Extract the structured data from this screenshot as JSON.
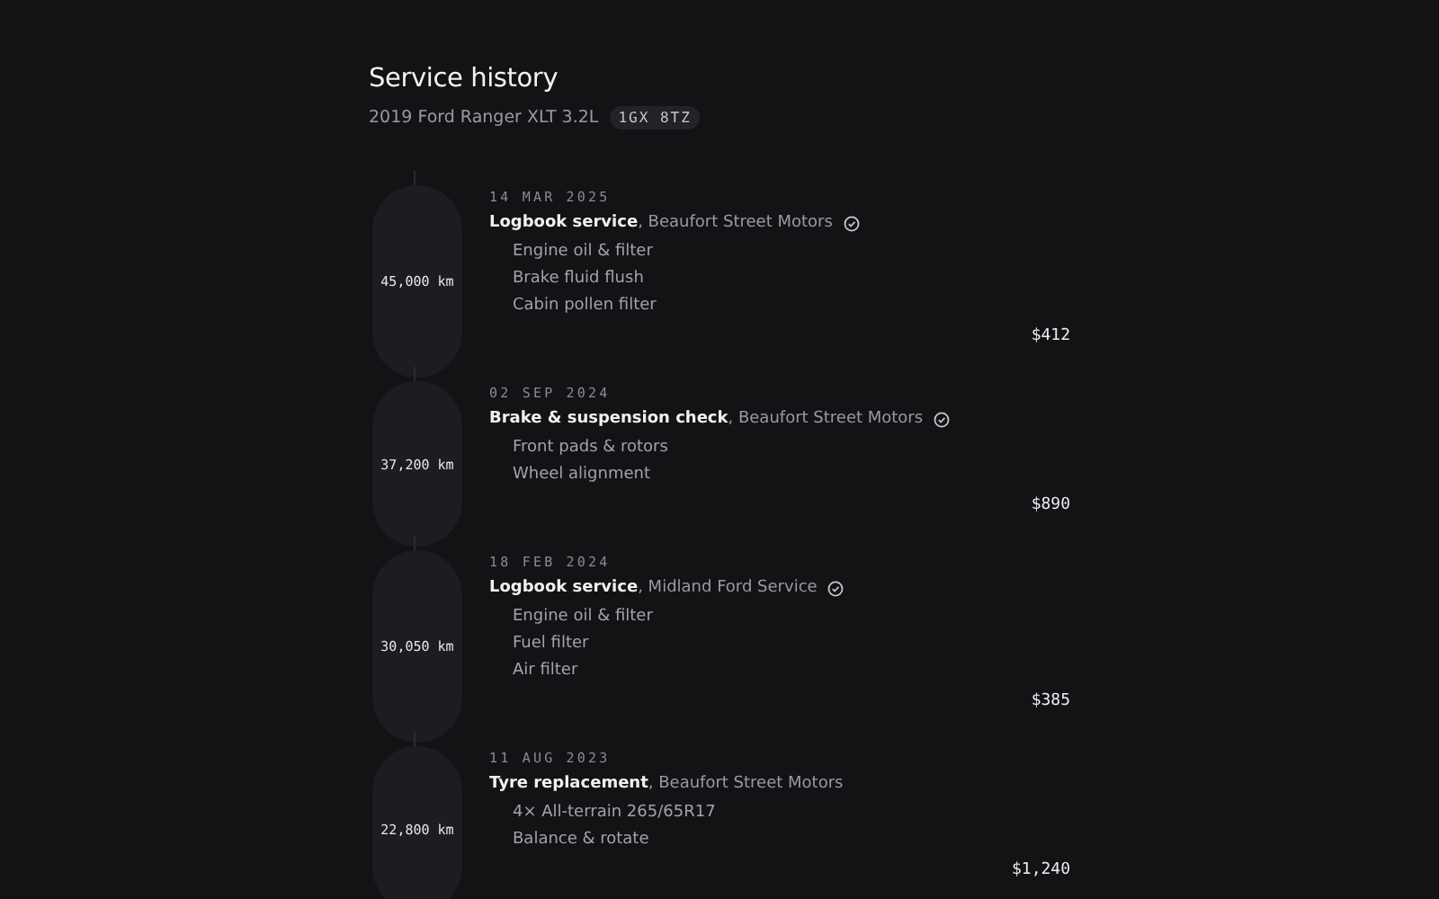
{
  "header": {
    "title": "Service history",
    "vehicle": "2019 Ford Ranger XLT 3.2L",
    "plate": "1GX 8TZ"
  },
  "entries": [
    {
      "odometer": "45,000 km",
      "date": "14 MAR 2025",
      "heading": "**Logbook service**, Beaufort Street Motors",
      "verified": true,
      "items": [
        "Engine oil & filter",
        "Brake fluid flush",
        "Cabin pollen filter"
      ],
      "cost": "$412"
    },
    {
      "odometer": "37,200 km",
      "date": "02 SEP 2024",
      "heading": "**Brake & suspension check**, Beaufort Street Motors",
      "verified": true,
      "items": [
        "Front pads & rotors",
        "Wheel alignment"
      ],
      "cost": "$890"
    },
    {
      "odometer": "30,050 km",
      "date": "18 FEB 2024",
      "heading": "**Logbook service**, Midland Ford Service",
      "verified": true,
      "items": [
        "Engine oil & filter",
        "Fuel filter",
        "Air filter"
      ],
      "cost": "$385"
    },
    {
      "odometer": "22,800 km",
      "date": "11 AUG 2023",
      "heading": "**Tyre replacement**, Beaufort Street Motors",
      "verified": false,
      "items": [
        "4× All-terrain 265/65R17",
        "Balance & rotate"
      ],
      "cost": "$1,240"
    }
  ]
}
